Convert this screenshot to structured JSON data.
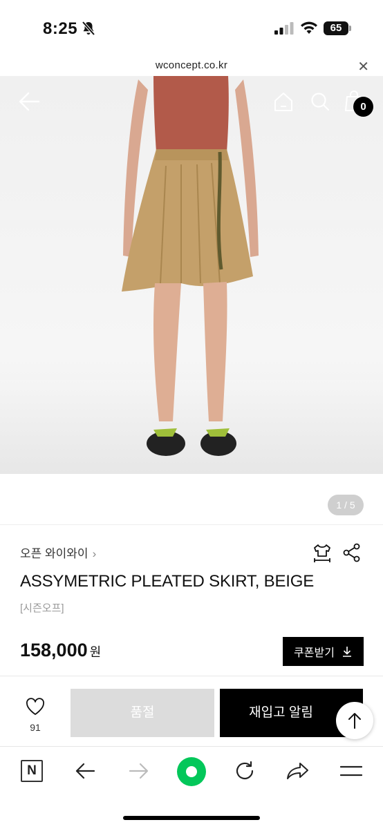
{
  "status_bar": {
    "time": "8:25",
    "battery": "65",
    "icons": [
      "bell-slash-icon",
      "signal-icon",
      "wifi-icon",
      "battery-icon"
    ]
  },
  "url_bar": {
    "url": "wconcept.co.kr",
    "close_icon": "close-icon"
  },
  "header": {
    "cart_count": "0",
    "icons": [
      "back-arrow-icon",
      "home-icon",
      "search-icon",
      "shopping-bag-icon"
    ]
  },
  "gallery": {
    "pager": "1 / 5"
  },
  "product": {
    "brand": "오픈 와이와이",
    "brand_chevron": "›",
    "title": "ASSYMETRIC PLEATED SKIRT, BEIGE",
    "subtitle": "[시즌오프]",
    "price": "158,000",
    "currency": "원",
    "coupon_label": "쿠폰받기"
  },
  "actions": {
    "like_count": "91",
    "soldout_label": "품절",
    "notify_label": "재입고 알림"
  },
  "browser_toolbar": {
    "n_logo": "N",
    "icons": [
      "naver-logo-icon",
      "back-icon",
      "forward-icon",
      "green-dot-icon",
      "refresh-icon",
      "share-icon",
      "menu-icon"
    ]
  },
  "colors": {
    "accent_black": "#000000",
    "soldout_gray": "#dcdcdc",
    "naver_green": "#03c75a",
    "skirt_beige": "#c4a06a",
    "top_rust": "#b25a4a"
  }
}
